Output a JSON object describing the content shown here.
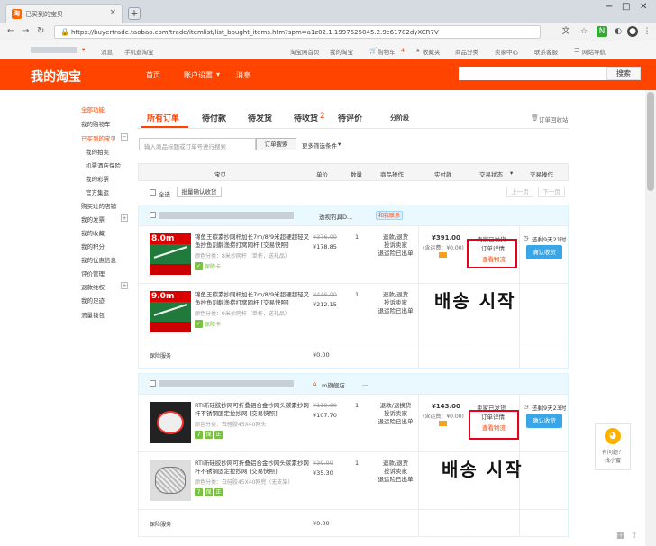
{
  "browser": {
    "tab_title": "已买到的宝贝",
    "favicon_text": "淘",
    "new_tab": "+",
    "url": "https://buyertrade.taobao.com/trade/itemlist/list_bought_items.htm?spm=a1z02.1.1997525045.2.9c61782dyXCR7V",
    "min": "−",
    "max": "□",
    "close": "✕"
  },
  "site_nav": {
    "left": [
      "消息",
      "手机逛淘宝"
    ],
    "right": [
      "淘宝网首页",
      "我的淘宝",
      "购物车",
      "收藏夹",
      "商品分类",
      "卖家中心",
      "联系客服",
      "网站导航"
    ],
    "cart_count": "4"
  },
  "header": {
    "logo": "我的淘宝",
    "nav": [
      "首页",
      "账户设置",
      "消息"
    ],
    "search_button": "搜索"
  },
  "sidebar": {
    "items": [
      "全部功能",
      "我的购物车",
      "已买到的宝贝",
      "我的拍卖",
      "机票酒店保险",
      "我的彩票",
      "官方集运",
      "购买过的店铺",
      "我的发票",
      "我的收藏",
      "我的积分",
      "我的优惠信息",
      "评价管理",
      "退款维权",
      "我的足迹",
      "流量钱包"
    ]
  },
  "order_tabs": {
    "tabs": [
      "所有订单",
      "待付款",
      "待发货",
      "待收货",
      "待评价",
      "分阶段"
    ],
    "pending_receipt_count": "2",
    "recycle": "订单回收站"
  },
  "search": {
    "placeholder": "输入商品标题或订单号进行搜索",
    "button": "订单搜索",
    "more": "更多筛选条件"
  },
  "table_header": {
    "columns": [
      "宝贝",
      "单价",
      "数量",
      "商品操作",
      "实付款",
      "交易状态",
      "交易操作"
    ],
    "select_all": "全选",
    "batch_confirm": "批量确认收货",
    "prev": "上一页",
    "next": "下一页"
  },
  "orders": [
    {
      "shop_label": "透视钓具D...",
      "badge": "和我联系",
      "items": [
        {
          "thumb_text": "8.0m",
          "title": "锦鱼王碳素抄网杆加长7m/8/9米超硬超轻叉鱼抄鱼割翻渔捞打窝网杆 [交易快照]",
          "spec": "颜色分类：8米抄网杆（单杆，送礼品）",
          "orig_price": "¥376.00",
          "price": "¥178.85",
          "qty": "1",
          "ops": [
            "退款/退货",
            "投诉卖家",
            "退运险已出单"
          ],
          "tag": "保障卡"
        },
        {
          "thumb_text": "9.0m",
          "title": "锦鱼王碳素抄网杆加长7m/8/9米超硬超轻叉鱼抄鱼割翻渔捞打窝网杆 [交易快照]",
          "spec": "颜色分类：9米抄网杆（单杆，送礼品）",
          "orig_price": "¥446.00",
          "price": "¥212.15",
          "qty": "1",
          "ops": [
            "退款/退货",
            "投诉卖家",
            "退运险已出单"
          ],
          "tag": "保障卡"
        }
      ],
      "insurance_label": "保险服务",
      "insurance_price": "¥0.00",
      "total": "¥391.00",
      "shipping": "(含运费：¥0.00)",
      "status": "卖家已发货",
      "order_detail": "订单详情",
      "logistics": "查看物流",
      "countdown": "还剩9天21时",
      "confirm": "确认收货",
      "annotation": "배송 시작"
    },
    {
      "shop_label": "...",
      "badge": "m旗舰店",
      "items": [
        {
          "thumb_text": "",
          "title": "RTI新硅胶抄网可折叠铝合金抄网头碳素抄网杆不锈钢固定拉抄网 [交易快照]",
          "spec": "颜色分类：白硅胶45X40网头",
          "orig_price": "¥119.00",
          "price": "¥107.70",
          "qty": "1",
          "ops": [
            "退款/退换货",
            "投诉卖家",
            "退运险已出单"
          ],
          "tags": [
            "7",
            "保",
            "正"
          ]
        },
        {
          "thumb_text": "",
          "title": "RTI新硅胶抄网可折叠铝合金抄网头碳素抄网杆不锈钢固定拉抄网 [交易快照]",
          "spec": "颜色分类：白硅胶45X40网兜（无支架）",
          "orig_price": "¥39.00",
          "price": "¥35.30",
          "qty": "1",
          "ops": [
            "退款/退货",
            "投诉卖家",
            "退运险已出单"
          ],
          "tags": [
            "7",
            "保",
            "正"
          ]
        }
      ],
      "insurance_label": "保险服务",
      "insurance_price": "¥0.00",
      "total": "¥143.00",
      "shipping": "(含运费：¥0.00)",
      "status": "卖家已发货",
      "order_detail": "订单详情",
      "logistics": "查看物流",
      "countdown": "还剩9天23时",
      "confirm": "确认收货",
      "annotation": "배송 시작"
    }
  ],
  "helper": {
    "line1": "有问题？",
    "line2": "找小蜜"
  },
  "colors": {
    "brand": "#ff4400",
    "confirm": "#39a6e8",
    "annotation_box": "#e8001c"
  }
}
